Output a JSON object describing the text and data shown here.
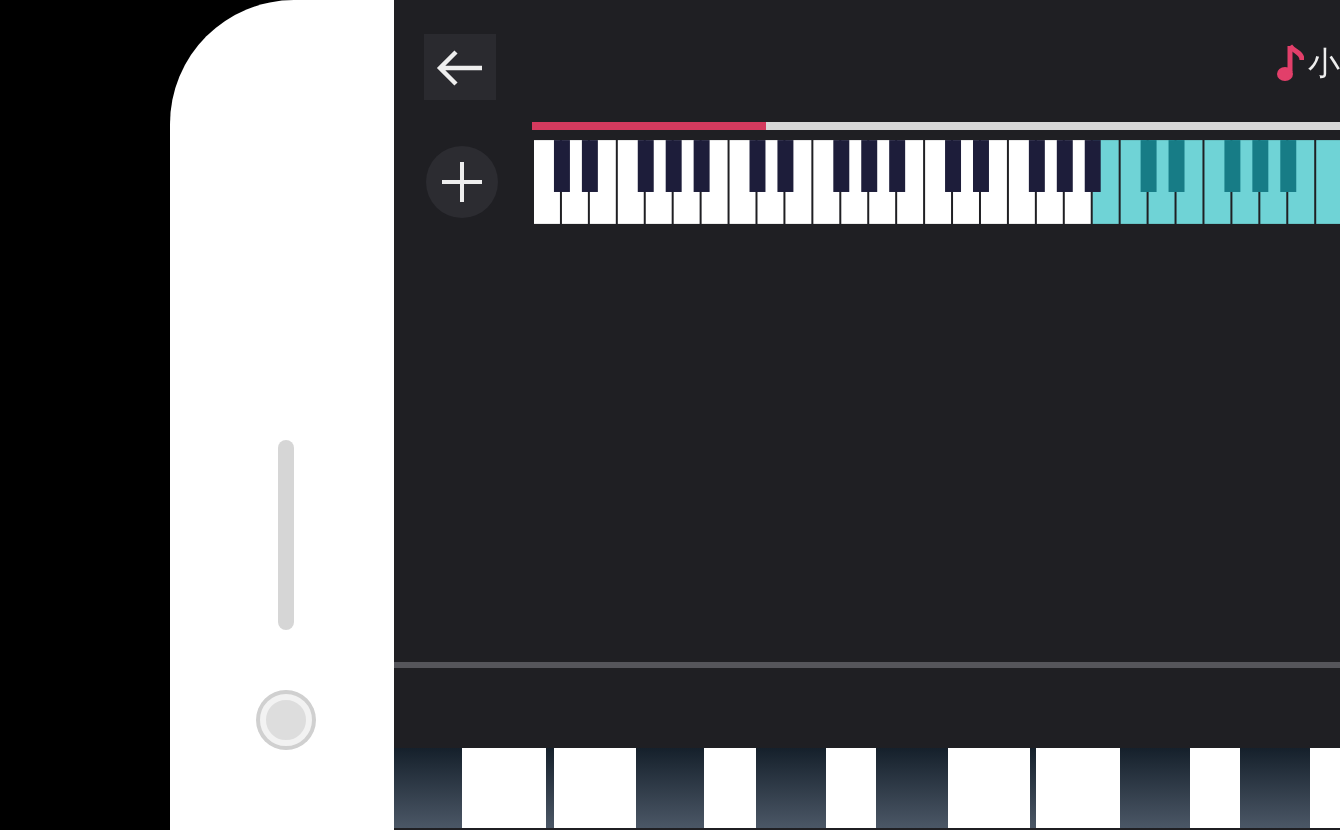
{
  "header": {
    "title": "小"
  },
  "progress": {
    "level": 0.29
  }
}
